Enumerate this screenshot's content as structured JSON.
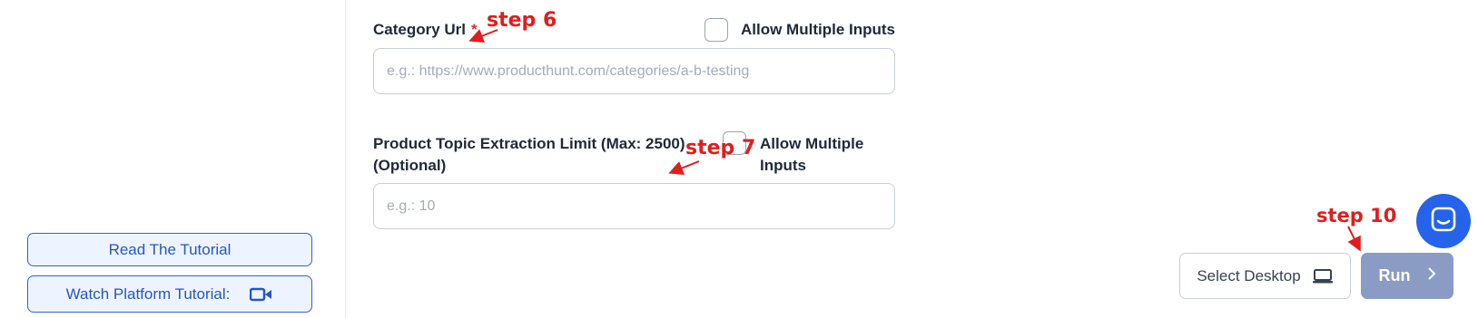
{
  "sidebar": {
    "read_tutorial_label": "Read The Tutorial",
    "watch_tutorial_label": "Watch Platform Tutorial:",
    "video_icon": "video-camera-icon"
  },
  "form": {
    "category_url": {
      "label": "Category Url",
      "required_mark": "*",
      "placeholder": "e.g.: https://www.producthunt.com/categories/a-b-testing",
      "value": "",
      "allow_multiple_label": "Allow Multiple Inputs",
      "allow_multiple_checked": false
    },
    "extraction_limit": {
      "label": "Product Topic Extraction Limit (Max: 2500) (Optional)",
      "placeholder": "e.g.: 10",
      "value": "",
      "allow_multiple_label": "Allow Multiple Inputs",
      "allow_multiple_checked": false
    }
  },
  "actions": {
    "select_desktop_label": "Select Desktop",
    "select_desktop_icon": "laptop-icon",
    "run_label": "Run",
    "run_icon": "chevron-right-icon"
  },
  "annotations": {
    "step6": "step 6",
    "step7": "step 7",
    "step10": "step 10"
  },
  "colors": {
    "accent": "#2563eb",
    "annotation": "#e11d1d",
    "run_button": "#8a9bc4"
  }
}
